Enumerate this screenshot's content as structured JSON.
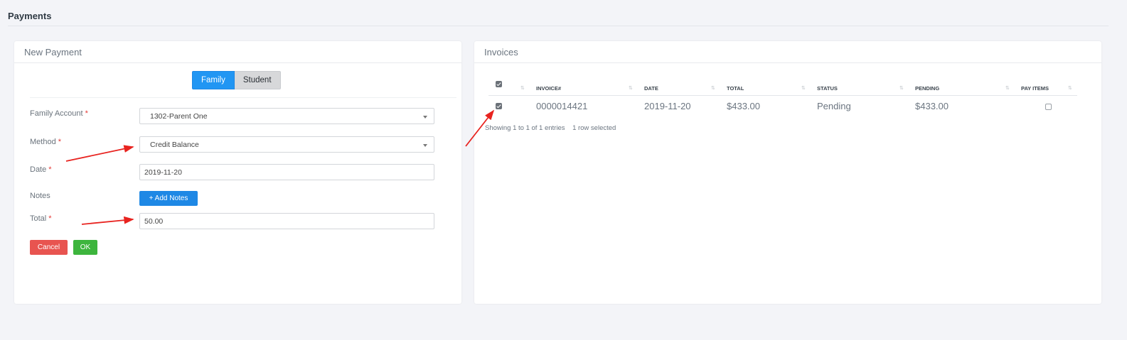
{
  "page": {
    "title": "Payments"
  },
  "new_payment": {
    "title": "New Payment",
    "toggle": {
      "family": "Family",
      "student": "Student"
    },
    "labels": {
      "family_account": "Family Account",
      "method": "Method",
      "date": "Date",
      "notes": "Notes",
      "total": "Total",
      "required": "*"
    },
    "values": {
      "family_account": "1302-Parent One",
      "method": "Credit Balance",
      "date": "2019-11-20",
      "total": "50.00"
    },
    "add_notes_label": "+ Add Notes",
    "cancel_label": "Cancel",
    "ok_label": "OK"
  },
  "invoices": {
    "title": "Invoices",
    "columns": [
      "INVOICE#",
      "DATE",
      "TOTAL",
      "STATUS",
      "PENDING",
      "PAY ITEMS"
    ],
    "rows": [
      {
        "invoice": "0000014421",
        "date": "2019-11-20",
        "total": "$433.00",
        "status": "Pending",
        "pending": "$433.00",
        "selected": true,
        "pay_items": false
      }
    ],
    "info": "Showing 1 to 1 of 1 entries",
    "selected_info": "1 row selected"
  },
  "colors": {
    "primary": "#2196f3",
    "cancel": "#e85450",
    "ok": "#3db53d",
    "annotation_arrow": "#e8231f"
  }
}
